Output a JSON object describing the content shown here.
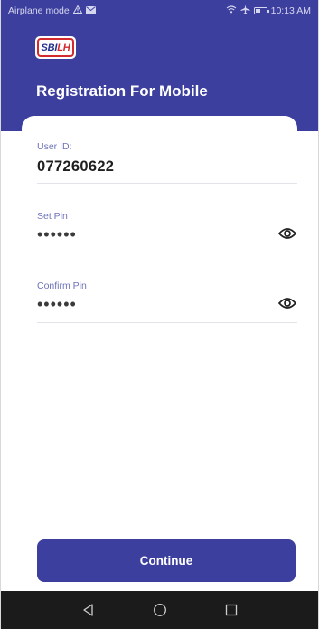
{
  "status_bar": {
    "left_text": "Airplane mode",
    "time": "10:13 AM",
    "icons": [
      "warning-icon",
      "mail-icon",
      "wifi-icon",
      "airplane-icon",
      "battery-icon"
    ],
    "battery_level": 0.35
  },
  "header": {
    "logo": {
      "part1": "SBI",
      "part2": "LH"
    },
    "title": "Registration For Mobile"
  },
  "form": {
    "user_id": {
      "label": "User ID:",
      "value": "077260622"
    },
    "set_pin": {
      "label": "Set Pin",
      "value": "••••••"
    },
    "confirm_pin": {
      "label": "Confirm Pin",
      "value": "••••••"
    }
  },
  "actions": {
    "continue_label": "Continue"
  },
  "colors": {
    "primary": "#3c3f9d",
    "label": "#6d73b8",
    "logo_red": "#d22a2f",
    "logo_blue": "#22318f",
    "navbar": "#1b1b1b"
  },
  "nav": {
    "icons": [
      "back-icon",
      "home-icon",
      "recents-icon"
    ]
  }
}
